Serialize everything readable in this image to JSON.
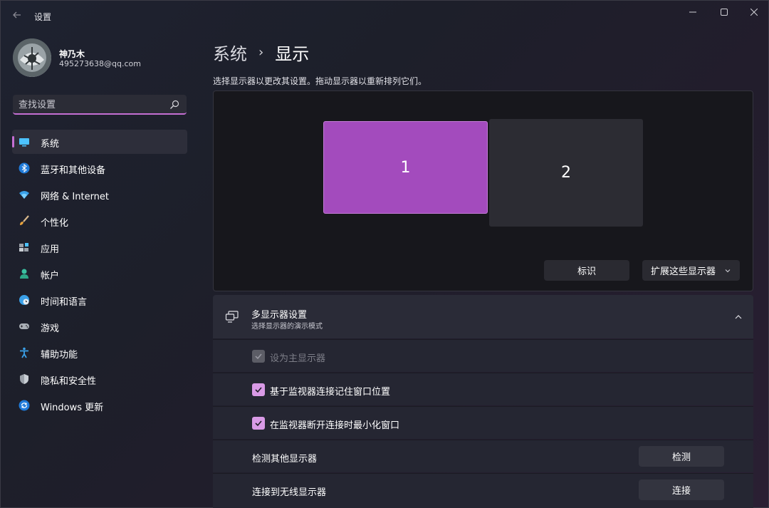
{
  "window": {
    "title": "设置",
    "back_icon": "back-arrow-icon",
    "minimize_icon": "minimize-icon",
    "maximize_icon": "maximize-icon",
    "close_icon": "close-icon"
  },
  "user": {
    "name": "神乃木",
    "email": "495273638@qq.com"
  },
  "search": {
    "placeholder": "查找设置",
    "icon": "search-icon"
  },
  "sidebar": {
    "items": [
      {
        "label": "系统",
        "icon": "monitor-icon",
        "active": true
      },
      {
        "label": "蓝牙和其他设备",
        "icon": "bluetooth-icon",
        "active": false
      },
      {
        "label": "网络 & Internet",
        "icon": "wifi-icon",
        "active": false
      },
      {
        "label": "个性化",
        "icon": "brush-icon",
        "active": false
      },
      {
        "label": "应用",
        "icon": "apps-icon",
        "active": false
      },
      {
        "label": "帐户",
        "icon": "person-icon",
        "active": false
      },
      {
        "label": "时间和语言",
        "icon": "globe-clock-icon",
        "active": false
      },
      {
        "label": "游戏",
        "icon": "gamepad-icon",
        "active": false
      },
      {
        "label": "辅助功能",
        "icon": "accessibility-icon",
        "active": false
      },
      {
        "label": "隐私和安全性",
        "icon": "shield-icon",
        "active": false
      },
      {
        "label": "Windows 更新",
        "icon": "update-icon",
        "active": false
      }
    ]
  },
  "main": {
    "breadcrumb_parent": "系统",
    "breadcrumb_sep": "›",
    "breadcrumb_current": "显示",
    "description": "选择显示器以更改其设置。拖动显示器以重新排列它们。",
    "monitors": [
      {
        "label": "1",
        "selected": true
      },
      {
        "label": "2",
        "selected": false
      }
    ],
    "identify_label": "标识",
    "mode_select_value": "扩展这些显示器",
    "multi_display": {
      "title": "多显示器设置",
      "subtitle": "选择显示器的演示模式",
      "icon": "multi-monitor-icon",
      "expanded": true
    },
    "checkboxes": [
      {
        "label": "设为主显示器",
        "checked": true,
        "disabled": true
      },
      {
        "label": "基于监视器连接记住窗口位置",
        "checked": true,
        "disabled": false
      },
      {
        "label": "在监视器断开连接时最小化窗口",
        "checked": true,
        "disabled": false
      }
    ],
    "detect_row": {
      "label": "检测其他显示器",
      "button": "检测"
    },
    "wireless_row": {
      "label": "连接到无线显示器",
      "button": "连接"
    }
  },
  "colors": {
    "accent": "#c56fd3",
    "monitor_selected": "#a34bbd",
    "checkbox": "#d99ae6"
  }
}
